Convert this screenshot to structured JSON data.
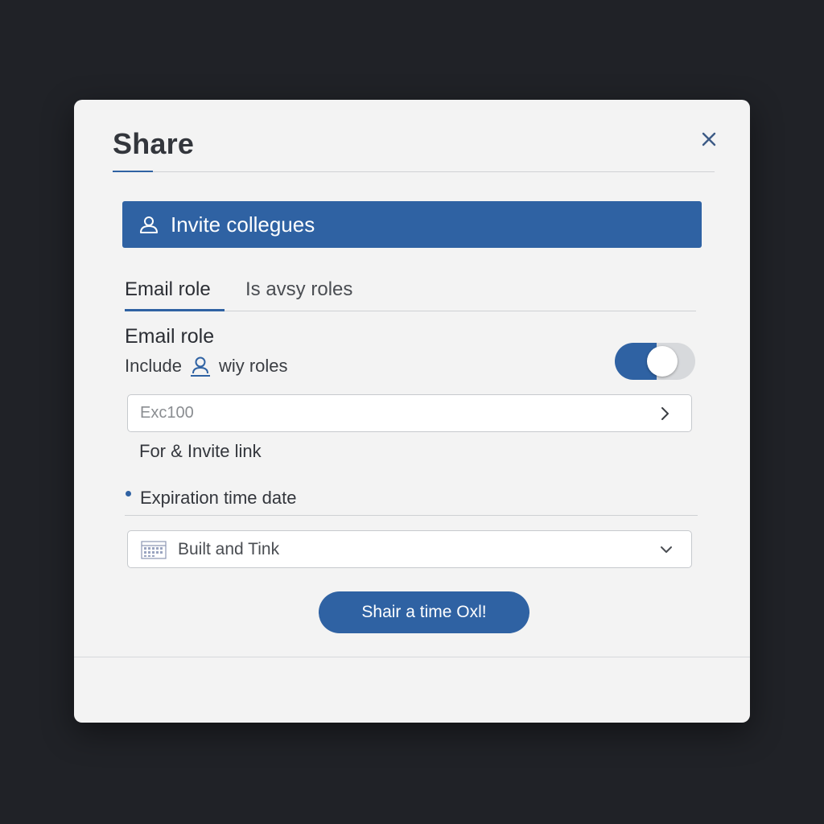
{
  "dialog": {
    "title": "Share",
    "close_icon": "close-icon"
  },
  "invite": {
    "label": "Invite collegues",
    "icon": "person-icon"
  },
  "tabs": [
    {
      "label": "Email role",
      "active": true
    },
    {
      "label": "Is avsy roles",
      "active": false
    }
  ],
  "email_role": {
    "title": "Email role",
    "include_prefix": "Include",
    "include_icon": "person-icon",
    "include_suffix": "wiy roles",
    "toggle_on": true
  },
  "input": {
    "placeholder": "Exc100",
    "icon": "chevron-right-icon"
  },
  "invite_link": {
    "label": "For & Invite link"
  },
  "expiration": {
    "label": "Expiration time date",
    "selected": "Built and Tink",
    "calendar_icon": "calendar-icon",
    "dropdown_icon": "chevron-down-icon"
  },
  "primary_button": {
    "label": "Shair a time Oxl!"
  },
  "colors": {
    "accent": "#2f62a3",
    "background": "#202227",
    "dialog": "#f3f3f3"
  }
}
